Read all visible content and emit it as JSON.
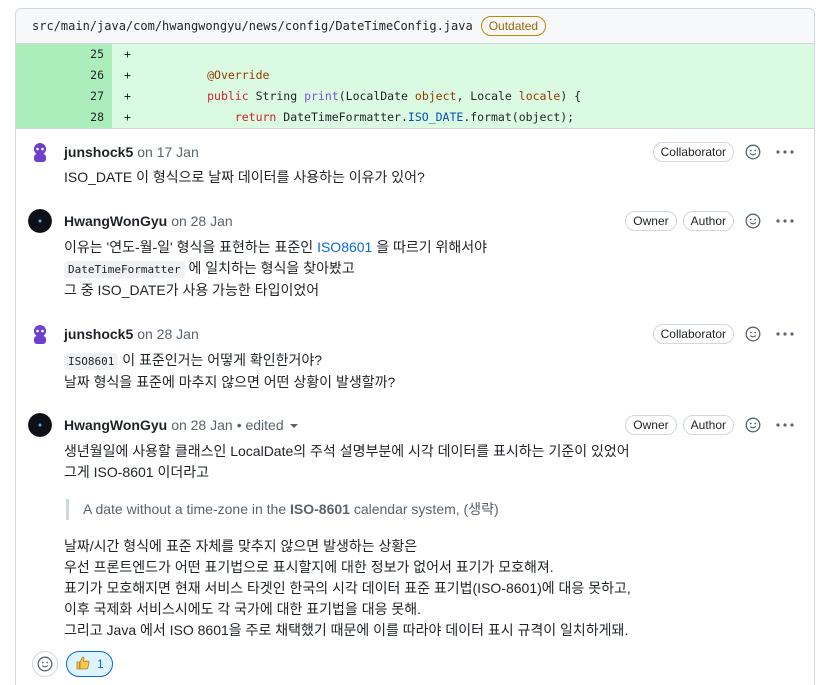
{
  "file": {
    "path": "src/main/java/com/hwangwongyu/news/config/DateTimeConfig.java",
    "badge": "Outdated"
  },
  "diff": [
    {
      "line": "25",
      "marker": "+"
    },
    {
      "line": "26",
      "marker": "+"
    },
    {
      "line": "27",
      "marker": "+"
    },
    {
      "line": "28",
      "marker": "+"
    }
  ],
  "code": {
    "l26_annotation": "@Override",
    "l27_kw": "public",
    "l27_type": "String",
    "l27_fn": "print",
    "l27_t1": "LocalDate",
    "l27_p1": "object",
    "l27_t2": "Locale",
    "l27_p2": "locale",
    "l28_kw": "return",
    "l28_cls": "DateTimeFormatter",
    "l28_const": "ISO_DATE",
    "l28_rest": ".format(object);"
  },
  "comments": [
    {
      "author": "junshock5",
      "date": "on 17 Jan",
      "roles": [
        "Collaborator"
      ],
      "lines": [
        "ISO_DATE 이 형식으로 날짜 데이터를 사용하는 이유가 있어?"
      ]
    },
    {
      "author": "HwangWonGyu",
      "date": "on 28 Jan",
      "roles": [
        "Owner",
        "Author"
      ],
      "l1_pre": "이유는 '연도-월-일' 형식을 표현하는 표준인 ",
      "l1_link": "ISO8601",
      "l1_post": " 을 따르기 위해서야",
      "l2_code": "DateTimeFormatter",
      "l2_post": " 에 일치하는 형식을 찾아봤고",
      "l3": "그 중 ISO_DATE가 사용 가능한 타입이었어"
    },
    {
      "author": "junshock5",
      "date": "on 28 Jan",
      "roles": [
        "Collaborator"
      ],
      "l1_code": "ISO8601",
      "l1_post": " 이 표준인거는 어떻게 확인한거야?",
      "l2": "날짜 형식을 표준에 마추지 않으면 어떤 상황이 발생할까?"
    },
    {
      "author": "HwangWonGyu",
      "date": "on 28 Jan",
      "edited": "• edited",
      "roles": [
        "Owner",
        "Author"
      ],
      "p1": "생년월일에 사용할 클래스인 LocalDate의 주석 설명부분에 시각 데이터를 표시하는 기준이 있었어",
      "p2": "그게 ISO-8601 이더라고",
      "quote_pre": "A date without a time-zone in the ",
      "quote_bold": "ISO-8601",
      "quote_post": " calendar system, (생략)",
      "p3": "날짜/시간 형식에 표준 자체를 맞추지 않으면 발생하는 상황은",
      "p4": "우선 프론트엔드가 어떤 표기법으로 표시할지에 대한 정보가 없어서 표기가 모호해져.",
      "p5": "표기가 모호해지면 현재 서비스 타겟인 한국의 시각 데이터 표준 표기법(ISO-8601)에 대응 못하고,",
      "p6": "이후 국제화 서비스시에도 각 국가에 대한 표기법을 대응 못해.",
      "p7": "그리고 Java 에서 ISO 8601을 주로 채택했기 때문에 이를 따라야 데이터 표시 규격이 일치하게돼."
    }
  ],
  "reactions": {
    "thumbs_up_count": "1"
  }
}
